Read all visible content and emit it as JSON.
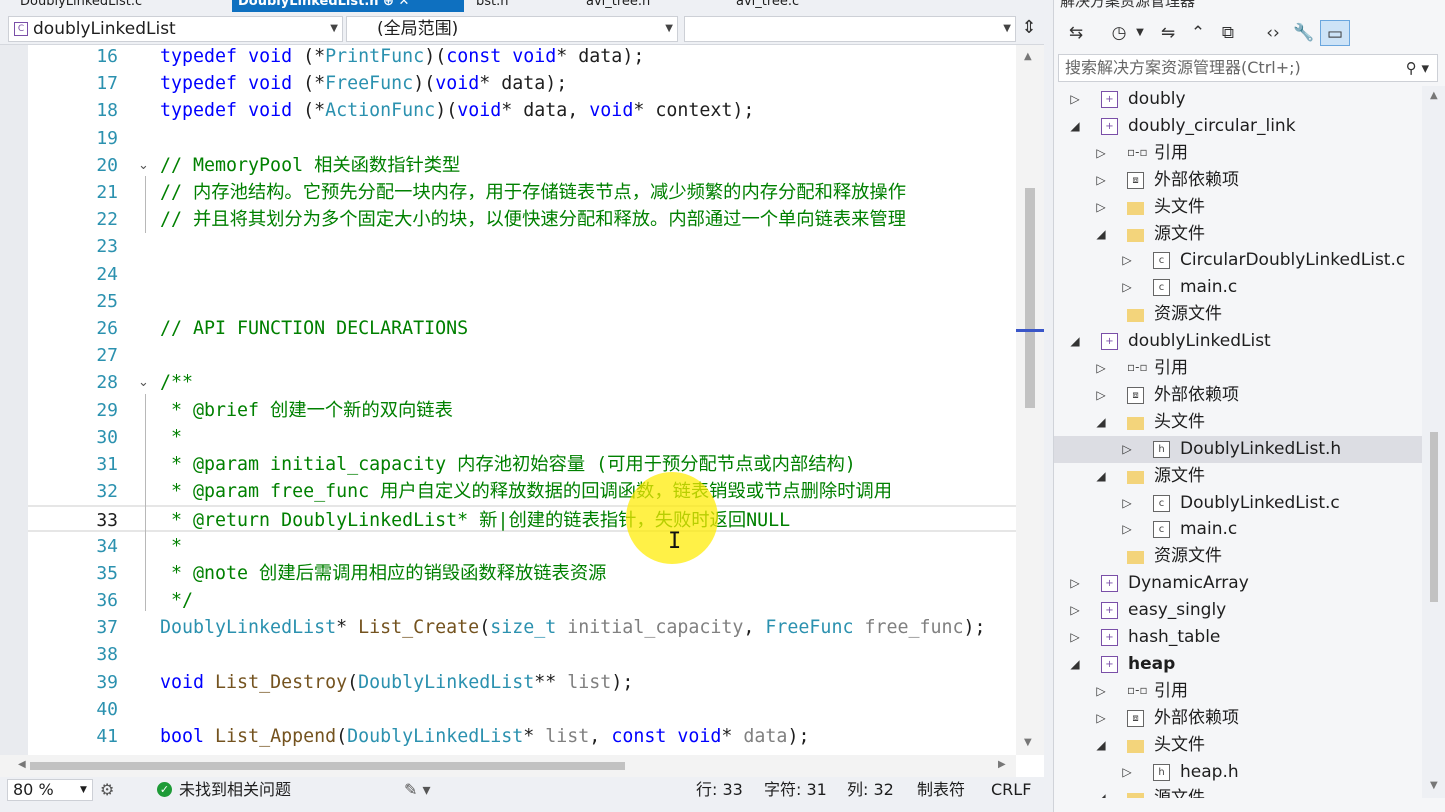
{
  "tabs": [
    {
      "label": "DoublyLinkedList.c",
      "active": false
    },
    {
      "label": "DoublyLinkedList.h  ⊕  ✕",
      "active": true
    },
    {
      "label": "bst.h",
      "active": false
    },
    {
      "label": "avl_tree.h",
      "active": false
    },
    {
      "label": "avl_tree.c",
      "active": false
    }
  ],
  "navbar": {
    "project": "doublyLinkedList",
    "scope": "(全局范围)",
    "member": ""
  },
  "code_lines": [
    {
      "n": "16",
      "html": "<span class='kw'>typedef</span> <span class='kw'>void</span> (*<span class='ty'>PrintFunc</span>)(<span class='kw'>const</span> <span class='kw'>void</span>* data);"
    },
    {
      "n": "17",
      "html": "<span class='kw'>typedef</span> <span class='kw'>void</span> (*<span class='ty'>FreeFunc</span>)(<span class='kw'>void</span>* data);"
    },
    {
      "n": "18",
      "html": "<span class='kw'>typedef</span> <span class='kw'>void</span> (*<span class='ty'>ActionFunc</span>)(<span class='kw'>void</span>* data, <span class='kw'>void</span>* context);"
    },
    {
      "n": "19",
      "html": ""
    },
    {
      "n": "20",
      "fold": true,
      "html": "<span class='cm'>// MemoryPool 相关函数指针类型</span>"
    },
    {
      "n": "21",
      "html": "<span class='cm'>// 内存池结构。它预先分配一块内存，用于存储链表节点，减少频繁的内存分配和释放操作</span>"
    },
    {
      "n": "22",
      "html": "<span class='cm'>// 并且将其划分为多个固定大小的块，以便快速分配和释放。内部通过一个单向链表来管理</span>"
    },
    {
      "n": "23",
      "html": ""
    },
    {
      "n": "24",
      "html": ""
    },
    {
      "n": "25",
      "html": ""
    },
    {
      "n": "26",
      "html": "<span class='cm'>// API FUNCTION DECLARATIONS</span>"
    },
    {
      "n": "27",
      "html": ""
    },
    {
      "n": "28",
      "fold": true,
      "html": "<span class='cm'>/**</span>"
    },
    {
      "n": "29",
      "html": "<span class='cm'> * @brief 创建一个新的双向链表</span>"
    },
    {
      "n": "30",
      "html": "<span class='cm'> *</span>"
    },
    {
      "n": "31",
      "html": "<span class='cm'> * @param initial_capacity 内存池初始容量 (可用于预分配节点或内部结构)</span>"
    },
    {
      "n": "32",
      "html": "<span class='cm'> * @param free_func 用户自定义的释放数据的回调函数，链表销毁或节点删除时调用</span>"
    },
    {
      "n": "33",
      "current": true,
      "html": "<span class='cm'> * @return DoublyLinkedList* 新|创建的链表指针，失败时返回NULL</span>"
    },
    {
      "n": "34",
      "html": "<span class='cm'> *</span>"
    },
    {
      "n": "35",
      "html": "<span class='cm'> * @note 创建后需调用相应的销毁函数释放链表资源</span>"
    },
    {
      "n": "36",
      "html": "<span class='cm'> */</span>"
    },
    {
      "n": "37",
      "html": "<span class='ty'>DoublyLinkedList</span>* <span class='fn'>List_Create</span>(<span class='ty'>size_t</span> <span class='pa'>initial_capacity</span>, <span class='ty'>FreeFunc</span> <span class='pa'>free_func</span>);"
    },
    {
      "n": "38",
      "html": ""
    },
    {
      "n": "39",
      "html": "<span class='kw'>void</span> <span class='fn'>List_Destroy</span>(<span class='ty'>DoublyLinkedList</span>** <span class='pa'>list</span>);"
    },
    {
      "n": "40",
      "html": ""
    },
    {
      "n": "41",
      "html": "<span class='kw'>bool</span> <span class='fn'>List_Append</span>(<span class='ty'>DoublyLinkedList</span>* <span class='pa'>list</span>, <span class='kw'>const</span> <span class='kw'>void</span>* <span class='pa'>data</span>);"
    }
  ],
  "status": {
    "zoom": "80 %",
    "issues": "未找到相关问题",
    "line": "行: 33",
    "char": "字符: 31",
    "col": "列: 32",
    "tabs": "制表符",
    "eol": "CRLF"
  },
  "solution_explorer": {
    "title": "解决方案资源管理器",
    "search_placeholder": "搜索解决方案资源管理器(Ctrl+;)",
    "nodes": [
      {
        "depth": 0,
        "expander": "▷",
        "icon": "proj",
        "label": "doubly"
      },
      {
        "depth": 0,
        "expander": "◢",
        "icon": "proj",
        "label": "doubly_circular_link"
      },
      {
        "depth": 1,
        "expander": "▷",
        "icon": "ref",
        "label": "引用"
      },
      {
        "depth": 1,
        "expander": "▷",
        "icon": "ext",
        "label": "外部依赖项"
      },
      {
        "depth": 1,
        "expander": "▷",
        "icon": "folder",
        "label": "头文件"
      },
      {
        "depth": 1,
        "expander": "◢",
        "icon": "folder",
        "label": "源文件"
      },
      {
        "depth": 2,
        "expander": "▷",
        "icon": "c",
        "label": "CircularDoublyLinkedList.c"
      },
      {
        "depth": 2,
        "expander": "▷",
        "icon": "c",
        "label": "main.c"
      },
      {
        "depth": 1,
        "expander": "",
        "icon": "folder",
        "label": "资源文件"
      },
      {
        "depth": 0,
        "expander": "◢",
        "icon": "proj",
        "label": "doublyLinkedList"
      },
      {
        "depth": 1,
        "expander": "▷",
        "icon": "ref",
        "label": "引用"
      },
      {
        "depth": 1,
        "expander": "▷",
        "icon": "ext",
        "label": "外部依赖项"
      },
      {
        "depth": 1,
        "expander": "◢",
        "icon": "folder",
        "label": "头文件"
      },
      {
        "depth": 2,
        "expander": "▷",
        "icon": "h",
        "label": "DoublyLinkedList.h",
        "selected": true
      },
      {
        "depth": 1,
        "expander": "◢",
        "icon": "folder",
        "label": "源文件"
      },
      {
        "depth": 2,
        "expander": "▷",
        "icon": "c",
        "label": "DoublyLinkedList.c"
      },
      {
        "depth": 2,
        "expander": "▷",
        "icon": "c",
        "label": "main.c"
      },
      {
        "depth": 1,
        "expander": "",
        "icon": "folder",
        "label": "资源文件"
      },
      {
        "depth": 0,
        "expander": "▷",
        "icon": "proj",
        "label": "DynamicArray"
      },
      {
        "depth": 0,
        "expander": "▷",
        "icon": "proj",
        "label": "easy_singly"
      },
      {
        "depth": 0,
        "expander": "▷",
        "icon": "proj",
        "label": "hash_table"
      },
      {
        "depth": 0,
        "expander": "◢",
        "icon": "proj",
        "label": "heap",
        "bold": true
      },
      {
        "depth": 1,
        "expander": "▷",
        "icon": "ref",
        "label": "引用"
      },
      {
        "depth": 1,
        "expander": "▷",
        "icon": "ext",
        "label": "外部依赖项"
      },
      {
        "depth": 1,
        "expander": "◢",
        "icon": "folder",
        "label": "头文件"
      },
      {
        "depth": 2,
        "expander": "▷",
        "icon": "h",
        "label": "heap.h"
      },
      {
        "depth": 1,
        "expander": "◢",
        "icon": "folder",
        "label": "源文件"
      }
    ]
  }
}
